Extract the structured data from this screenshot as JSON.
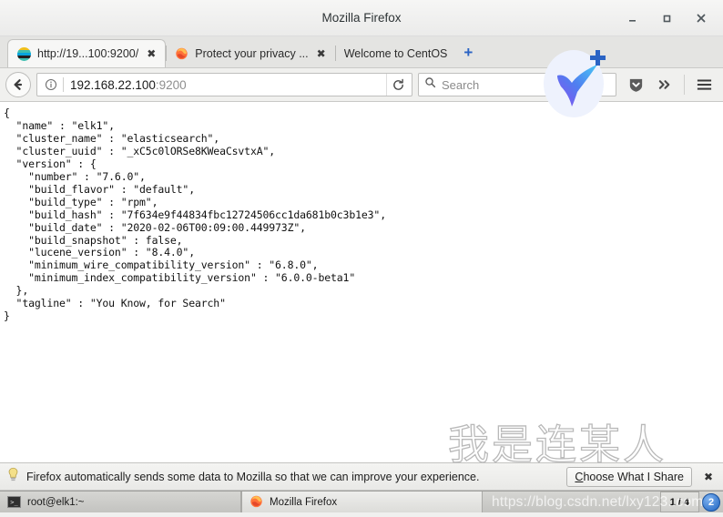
{
  "window": {
    "title": "Mozilla Firefox",
    "controls": {
      "minimize": "minimize",
      "maximize": "maximize",
      "close": "close"
    }
  },
  "tabs": [
    {
      "label": "http://19...100:9200/",
      "favicon": "elasticsearch-icon",
      "close": "✖",
      "active": true
    },
    {
      "label": "Protect your privacy ...",
      "favicon": "firefox-icon",
      "close": "✖",
      "active": false
    },
    {
      "label": "Welcome to CentOS",
      "favicon": "none",
      "close": "",
      "active": false
    }
  ],
  "newtab_label": "+",
  "toolbar": {
    "back_icon": "back-arrow-icon",
    "identity_icon": "info-icon",
    "url_host": "192.168.22.100",
    "url_port": ":9200",
    "reload_icon": "reload-icon",
    "search_placeholder": "Search",
    "search_icon": "search-icon",
    "pocket_icon": "pocket-shield-icon",
    "overflow_icon": "double-chevron-icon",
    "menu_icon": "hamburger-menu-icon"
  },
  "content": {
    "json_body": "{\n  \"name\" : \"elk1\",\n  \"cluster_name\" : \"elasticsearch\",\n  \"cluster_uuid\" : \"_xC5c0lORSe8KWeaCsvtxA\",\n  \"version\" : {\n    \"number\" : \"7.6.0\",\n    \"build_flavor\" : \"default\",\n    \"build_type\" : \"rpm\",\n    \"build_hash\" : \"7f634e9f44834fbc12724506cc1da681b0c3b1e3\",\n    \"build_date\" : \"2020-02-06T00:09:00.449973Z\",\n    \"build_snapshot\" : false,\n    \"lucene_version\" : \"8.4.0\",\n    \"minimum_wire_compatibility_version\" : \"6.8.0\",\n    \"minimum_index_compatibility_version\" : \"6.0.0-beta1\"\n  },\n  \"tagline\" : \"You Know, for Search\"\n}",
    "watermark_cn": "我是连某人"
  },
  "notification": {
    "icon": "lightbulb-icon",
    "message": "Firefox automatically sends some data to Mozilla so that we can improve your experience.",
    "button_prefix": "C",
    "button_rest": "hoose What I Share",
    "close": "✖"
  },
  "taskbar": {
    "items": [
      {
        "icon": "terminal-icon",
        "label": "root@elk1:~"
      },
      {
        "icon": "firefox-icon",
        "label": "Mozilla Firefox"
      }
    ],
    "pager": "1 / 4",
    "tray_badge": "2",
    "watermark_url": "https://blog.csdn.net/lxy123..com"
  },
  "colors": {
    "accent": "#2a63c4",
    "titlebar_bg": "#f6f6f5",
    "tabstrip_bg": "#e4e4e2",
    "content_bg": "#ffffff",
    "taskbar_bg": "#c3c3c0"
  }
}
